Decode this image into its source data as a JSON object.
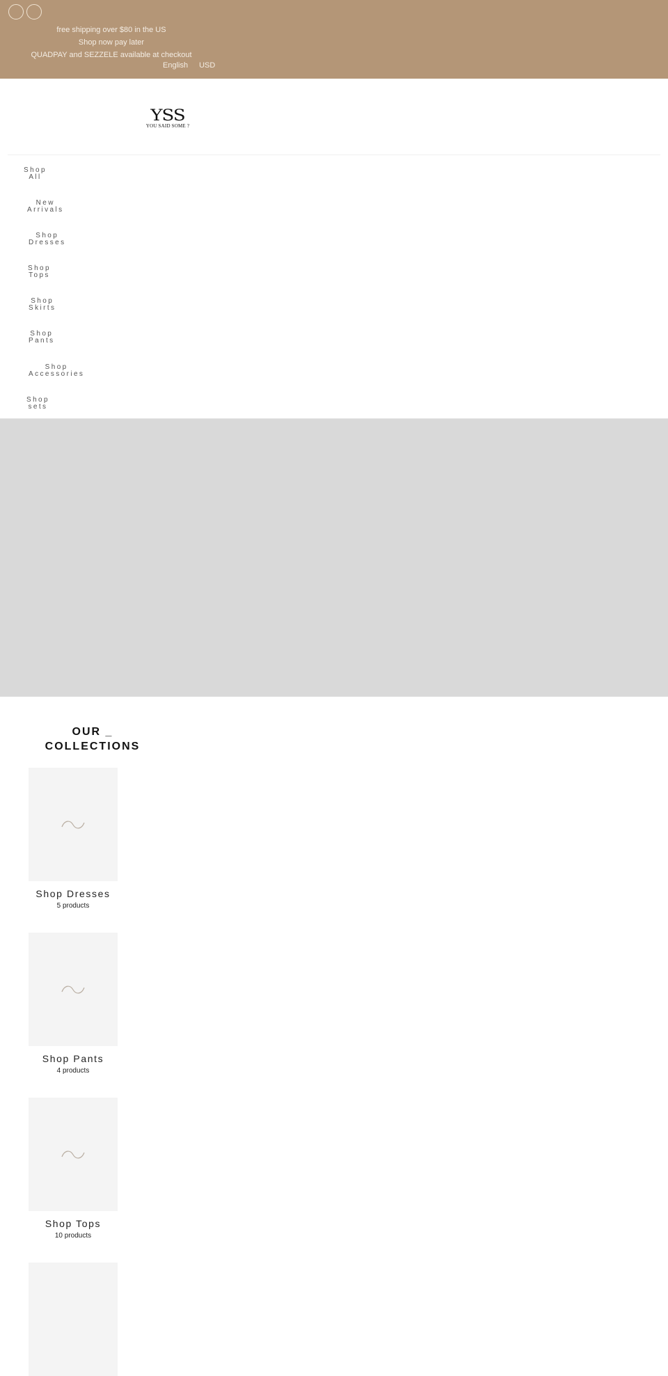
{
  "announcement": {
    "icons": [
      "circle-icon",
      "circle-icon"
    ],
    "lines": [
      "free shipping over $80 in the US",
      "Shop now pay later",
      "QUADPAY and SEZZELE available at checkout"
    ],
    "language": "English",
    "currency": "USD"
  },
  "header": {
    "logo_mark": "YSS",
    "logo_subtitle": "YOU SAID SOME ?"
  },
  "nav": {
    "items": [
      {
        "line1": "Shop",
        "line2": "All"
      },
      {
        "line1": "New",
        "line2": "Arrivals"
      },
      {
        "line1": "Shop",
        "line2": "Dresses"
      },
      {
        "line1": "Shop",
        "line2": "Tops"
      },
      {
        "line1": "Shop",
        "line2": "Skirts"
      },
      {
        "line1": "Shop",
        "line2": "Pants"
      },
      {
        "line1": "Shop",
        "line2": "Accessories"
      },
      {
        "line1": "Shop",
        "line2": "sets"
      }
    ]
  },
  "collections": {
    "title_line1": "OUR _",
    "title_line2": "COLLECTIONS",
    "items": [
      {
        "name": "Shop Dresses",
        "count": "5 products"
      },
      {
        "name": "Shop Pants",
        "count": "4 products"
      },
      {
        "name": "Shop Tops",
        "count": "10 products"
      },
      {
        "name": "",
        "count": ""
      }
    ]
  },
  "colors": {
    "announcement_bg": "#b49677",
    "announcement_text": "#f4ede4",
    "hero_bg": "#d9d9d9",
    "card_bg": "#f4f4f4"
  }
}
